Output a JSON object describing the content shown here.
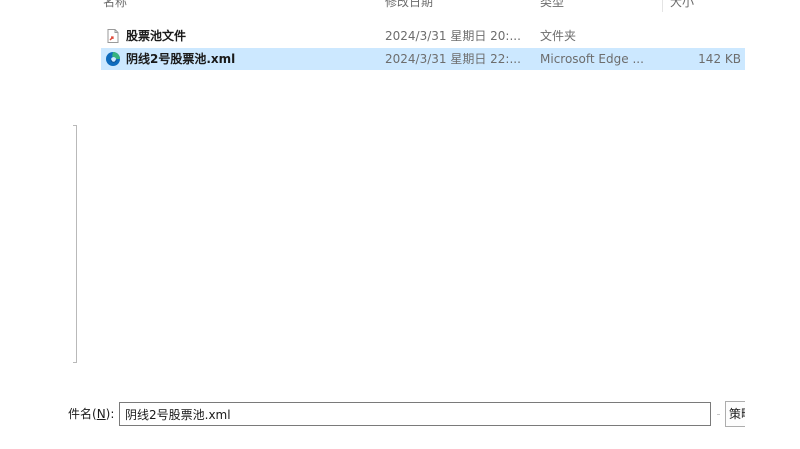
{
  "columns": {
    "name": "名称",
    "date": "修改日期",
    "type": "类型",
    "size": "大小"
  },
  "files": [
    {
      "name": "股票池文件",
      "date": "2024/3/31 星期日 20:...",
      "type": "文件夹",
      "size": "",
      "icon": "folder-shortcut-icon",
      "selected": false
    },
    {
      "name": "阴线2号股票池.xml",
      "date": "2024/3/31 星期日 22:...",
      "type": "Microsoft Edge ...",
      "size": "142 KB",
      "icon": "edge-icon",
      "selected": true
    }
  ],
  "filename": {
    "label_prefix": "件名(",
    "label_accel": "N",
    "label_suffix": "):",
    "value": "阴线2号股票池.xml"
  },
  "filter": {
    "label": "策略"
  },
  "colors": {
    "selection": "#cce8ff",
    "edge_blue": "#0f6cbd",
    "edge_green": "#36b37e"
  }
}
